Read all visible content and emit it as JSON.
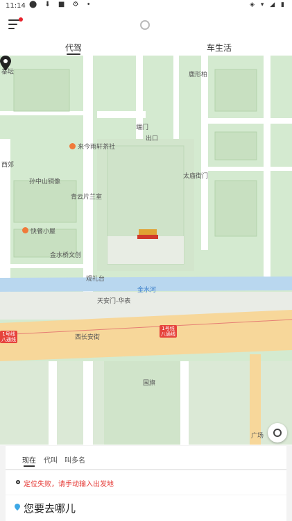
{
  "status": {
    "time": "11:14"
  },
  "tabs": {
    "daijia": "代驾",
    "chesh": "车生活"
  },
  "map_labels": {
    "taikang": "泰坛",
    "luxing": "鹿形柏",
    "duanmen": "端门",
    "chukou": "出口",
    "laijinyu": "来今雨轩茶社",
    "xiangji": "西郊",
    "sunzhongshan": "孙中山铜像",
    "taimiao": "太庙街门",
    "qingyun": "青云片兰室",
    "kuaican": "快餐小屋",
    "jinshui": "金水桥文创",
    "guanlitai": "观礼台",
    "jinshuihe": "金水河",
    "tiananmen": "天安门-华表",
    "xichangan": "西长安街",
    "guoqi": "国旗",
    "guangchang": "广场",
    "metro_left": "1号线\n八通线",
    "metro_right": "1号线\n八通线"
  },
  "ride_modes": {
    "now": "现在",
    "call_for": "代叫",
    "multi": "叫多名"
  },
  "from_text": "定位失败，请手动输入出发地",
  "to_text": "您要去哪儿"
}
